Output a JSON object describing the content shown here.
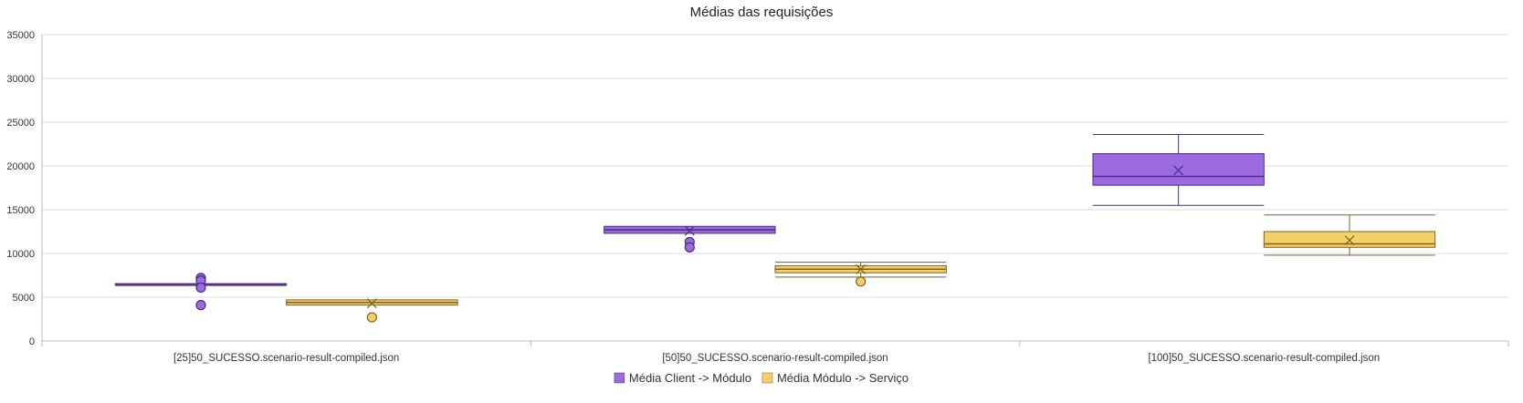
{
  "chart_data": {
    "type": "boxplot",
    "title": "Médias das requisições",
    "xlabel": "",
    "ylabel": "",
    "ylim": [
      0,
      35000
    ],
    "yticks": [
      0,
      5000,
      10000,
      15000,
      20000,
      25000,
      30000,
      35000
    ],
    "grid": true,
    "legend_position": "bottom",
    "categories": [
      "[25]50_SUCESSO.scenario-result-compiled.json",
      "[50]50_SUCESSO.scenario-result-compiled.json",
      "[100]50_SUCESSO.scenario-result-compiled.json"
    ],
    "series": [
      {
        "name": "Média Client -> Módulo",
        "color": "#9b6ae0",
        "stroke": "#4b2d82",
        "boxes": [
          {
            "min": 6500,
            "q1": 6450,
            "median": 6500,
            "q3": 6550,
            "max": 6500,
            "mean": 6500,
            "outliers": [
              7200,
              6900,
              6100,
              4100
            ]
          },
          {
            "min": 12300,
            "q1": 12300,
            "median": 12700,
            "q3": 13100,
            "max": 13100,
            "mean": 12600,
            "outliers": [
              11300,
              10700
            ]
          },
          {
            "min": 15500,
            "q1": 17800,
            "median": 18800,
            "q3": 21400,
            "max": 23600,
            "mean": 19500,
            "outliers": []
          }
        ]
      },
      {
        "name": "Média Módulo -> Serviço",
        "color": "#f4cf6a",
        "stroke": "#7a6326",
        "boxes": [
          {
            "min": 4400,
            "q1": 4100,
            "median": 4400,
            "q3": 4700,
            "max": 4400,
            "mean": 4300,
            "outliers": [
              2700
            ]
          },
          {
            "min": 7300,
            "q1": 7800,
            "median": 8200,
            "q3": 8600,
            "max": 9000,
            "mean": 8200,
            "outliers": [
              6800
            ]
          },
          {
            "min": 9800,
            "q1": 10700,
            "median": 11100,
            "q3": 12500,
            "max": 14400,
            "mean": 11500,
            "outliers": []
          }
        ]
      }
    ]
  }
}
